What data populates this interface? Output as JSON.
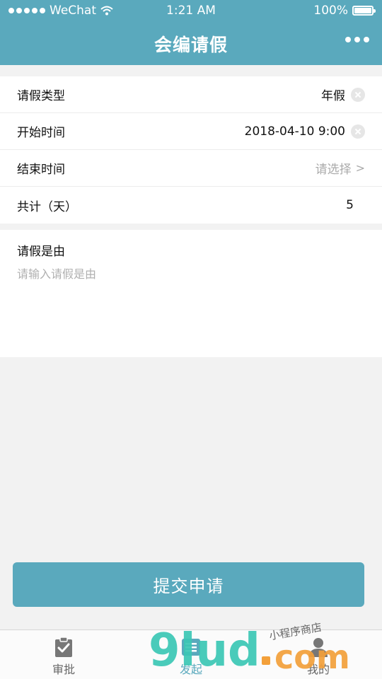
{
  "status_bar": {
    "carrier": "WeChat",
    "time": "1:21 AM",
    "battery": "100%",
    "battery_level": 1.0
  },
  "header": {
    "title": "会编请假"
  },
  "form": {
    "rows": [
      {
        "label": "请假类型",
        "value": "年假"
      },
      {
        "label": "开始时间",
        "value": "2018-04-10 9:00"
      },
      {
        "label": "结束时间",
        "placeholder": "请选择",
        "chevron": ">"
      },
      {
        "label": "共计（天）",
        "value": "5"
      }
    ]
  },
  "reason": {
    "label": "请假是由",
    "placeholder": "请输入请假是由"
  },
  "submit": {
    "label": "提交申请"
  },
  "tabs": [
    {
      "label": "审批",
      "icon": "clipboard-check-icon"
    },
    {
      "label": "发起",
      "icon": "list-icon",
      "active": true
    },
    {
      "label": "我的",
      "icon": "user-icon"
    }
  ],
  "watermark": {
    "main": "9lud",
    "com": "com",
    "small": "小程序商店"
  },
  "colors": {
    "primary": "#5aa9bd",
    "background": "#f2f2f2",
    "placeholder": "#b0b0b0"
  }
}
